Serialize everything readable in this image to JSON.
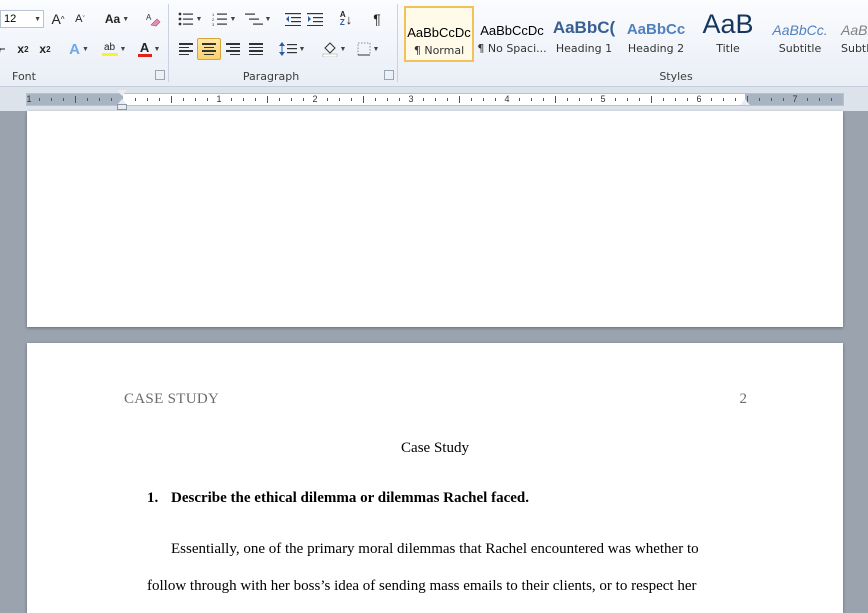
{
  "ribbon": {
    "font_group": {
      "label": "Font",
      "font_size": "12",
      "grow_font": "A",
      "shrink_font": "A",
      "change_case": "Aa",
      "subscript": "x",
      "subscript_mark": "2",
      "superscript": "x",
      "superscript_mark": "2",
      "text_effects": "A",
      "highlight": "ab",
      "font_color": "A",
      "font_color_hex": "#e0201a",
      "highlight_hex": "#f7f32a"
    },
    "paragraph_group": {
      "label": "Paragraph",
      "pilcrow": "¶",
      "sort_a": "A",
      "sort_z": "Z"
    },
    "styles_group": {
      "label": "Styles",
      "items": [
        {
          "preview": "AaBbCcDc",
          "name": "¶ Normal",
          "selected": true,
          "color": "#000000"
        },
        {
          "preview": "AaBbCcDc",
          "name": "¶ No Spaci...",
          "selected": false,
          "color": "#000000"
        },
        {
          "preview": "AaBbC(",
          "name": "Heading 1",
          "selected": false,
          "color": "#365f91"
        },
        {
          "preview": "AaBbCc",
          "name": "Heading 2",
          "selected": false,
          "color": "#4f81bd"
        },
        {
          "preview": "AaB",
          "name": "Title",
          "selected": false,
          "color": "#17365d"
        },
        {
          "preview": "AaBbCc.",
          "name": "Subtitle",
          "selected": false,
          "color": "#4f81bd"
        },
        {
          "preview": "AaBbCc",
          "name": "Subtl",
          "selected": false,
          "color": "#808080"
        }
      ]
    }
  },
  "ruler": {
    "numbers": [
      "1",
      "1",
      "2",
      "3",
      "4",
      "5",
      "6",
      "7"
    ]
  },
  "document": {
    "header_left": "CASE STUDY",
    "header_right": "2",
    "title": "Case Study",
    "question_number": "1.",
    "question_text": "Describe the ethical dilemma or dilemmas Rachel faced.",
    "paragraph_line1": "Essentially, one of the primary moral dilemmas that Rachel encountered was whether to",
    "paragraph_line2": "follow through with her boss’s idea of sending mass emails to their clients, or to respect her"
  }
}
